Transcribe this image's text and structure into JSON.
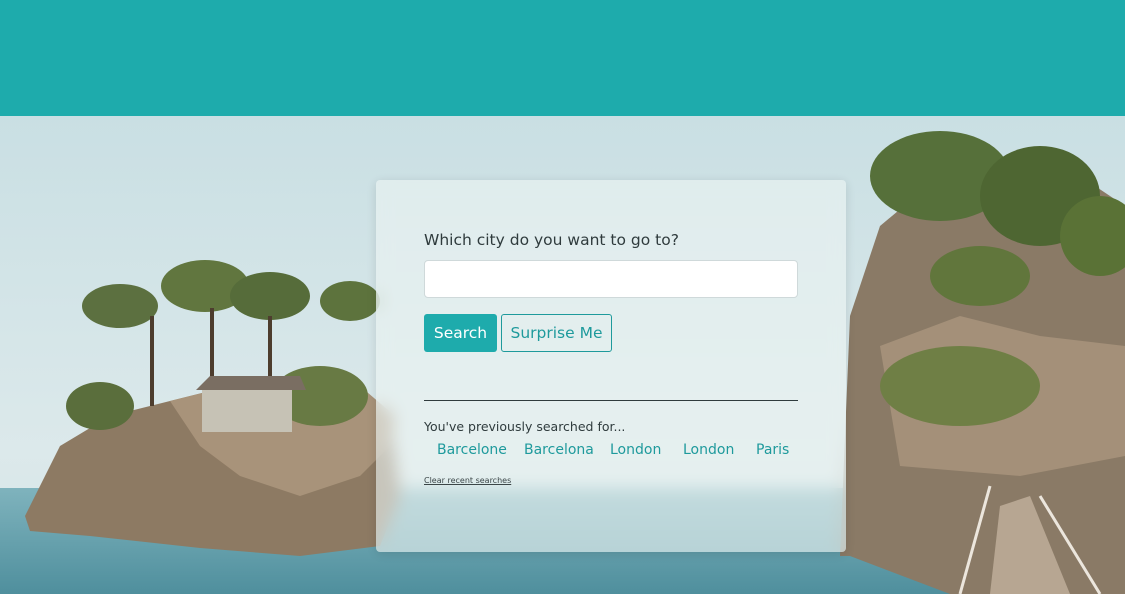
{
  "search": {
    "prompt": "Which city do you want to go to?",
    "value": "",
    "placeholder": "",
    "search_label": "Search",
    "surprise_label": "Surprise Me"
  },
  "recent": {
    "label": "You've previously searched for...",
    "items": [
      "Barcelone",
      "Barcelona",
      "London",
      "London",
      "Paris"
    ],
    "clear_label": "Clear recent searches"
  },
  "colors": {
    "accent": "#1eabac",
    "link": "#1e9a9c",
    "text": "#2f3b3d"
  },
  "background": {
    "image": "coastal island landscape with cliffs, pine trees and a wooden rope bridge"
  }
}
